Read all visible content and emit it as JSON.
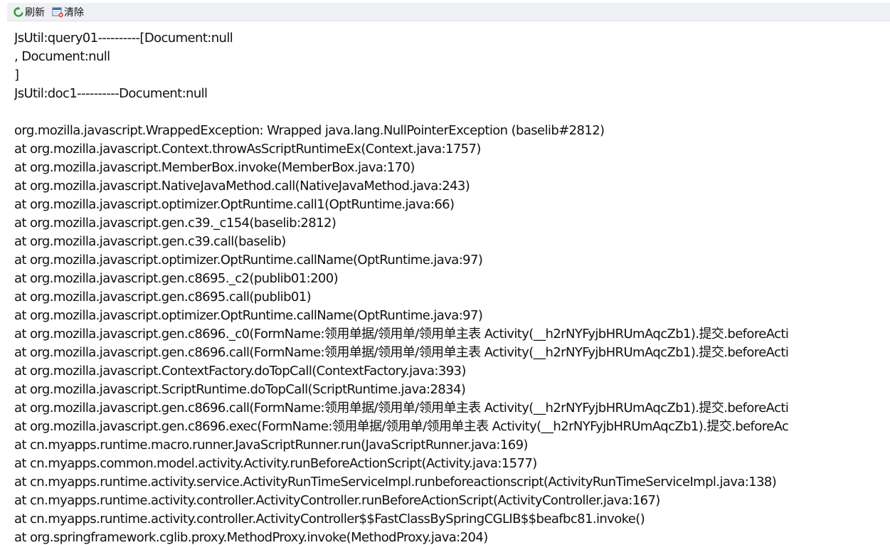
{
  "toolbar": {
    "refresh_label": "刷新",
    "clear_label": "清除",
    "refresh_icon": "refresh-icon",
    "clear_icon": "clear-icon"
  },
  "log": {
    "lines": [
      "JsUtil:query01----------[Document:null",
      ", Document:null",
      "]",
      "JsUtil:doc1----------Document:null",
      "",
      "org.mozilla.javascript.WrappedException: Wrapped java.lang.NullPointerException (baselib#2812)",
      "at org.mozilla.javascript.Context.throwAsScriptRuntimeEx(Context.java:1757)",
      "at org.mozilla.javascript.MemberBox.invoke(MemberBox.java:170)",
      "at org.mozilla.javascript.NativeJavaMethod.call(NativeJavaMethod.java:243)",
      "at org.mozilla.javascript.optimizer.OptRuntime.call1(OptRuntime.java:66)",
      "at org.mozilla.javascript.gen.c39._c154(baselib:2812)",
      "at org.mozilla.javascript.gen.c39.call(baselib)",
      "at org.mozilla.javascript.optimizer.OptRuntime.callName(OptRuntime.java:97)",
      "at org.mozilla.javascript.gen.c8695._c2(publib01:200)",
      "at org.mozilla.javascript.gen.c8695.call(publib01)",
      "at org.mozilla.javascript.optimizer.OptRuntime.callName(OptRuntime.java:97)",
      "at org.mozilla.javascript.gen.c8696._c0(FormName:领用单据/领用单/领用单主表 Activity(__h2rNYFyjbHRUmAqcZb1).提交.beforeActi",
      "at org.mozilla.javascript.gen.c8696.call(FormName:领用单据/领用单/领用单主表 Activity(__h2rNYFyjbHRUmAqcZb1).提交.beforeActi",
      "at org.mozilla.javascript.ContextFactory.doTopCall(ContextFactory.java:393)",
      "at org.mozilla.javascript.ScriptRuntime.doTopCall(ScriptRuntime.java:2834)",
      "at org.mozilla.javascript.gen.c8696.call(FormName:领用单据/领用单/领用单主表 Activity(__h2rNYFyjbHRUmAqcZb1).提交.beforeActi",
      "at org.mozilla.javascript.gen.c8696.exec(FormName:领用单据/领用单/领用单主表 Activity(__h2rNYFyjbHRUmAqcZb1).提交.beforeAc",
      "at cn.myapps.runtime.macro.runner.JavaScriptRunner.run(JavaScriptRunner.java:169)",
      "at cn.myapps.common.model.activity.Activity.runBeforeActionScript(Activity.java:1577)",
      "at cn.myapps.runtime.activity.service.ActivityRunTimeServiceImpl.runbeforeactionscript(ActivityRunTimeServiceImpl.java:138)",
      "at cn.myapps.runtime.activity.controller.ActivityController.runBeforeActionScript(ActivityController.java:167)",
      "at cn.myapps.runtime.activity.controller.ActivityController$$FastClassBySpringCGLIB$$beafbc81.invoke()",
      "at org.springframework.cglib.proxy.MethodProxy.invoke(MethodProxy.java:204)"
    ]
  }
}
